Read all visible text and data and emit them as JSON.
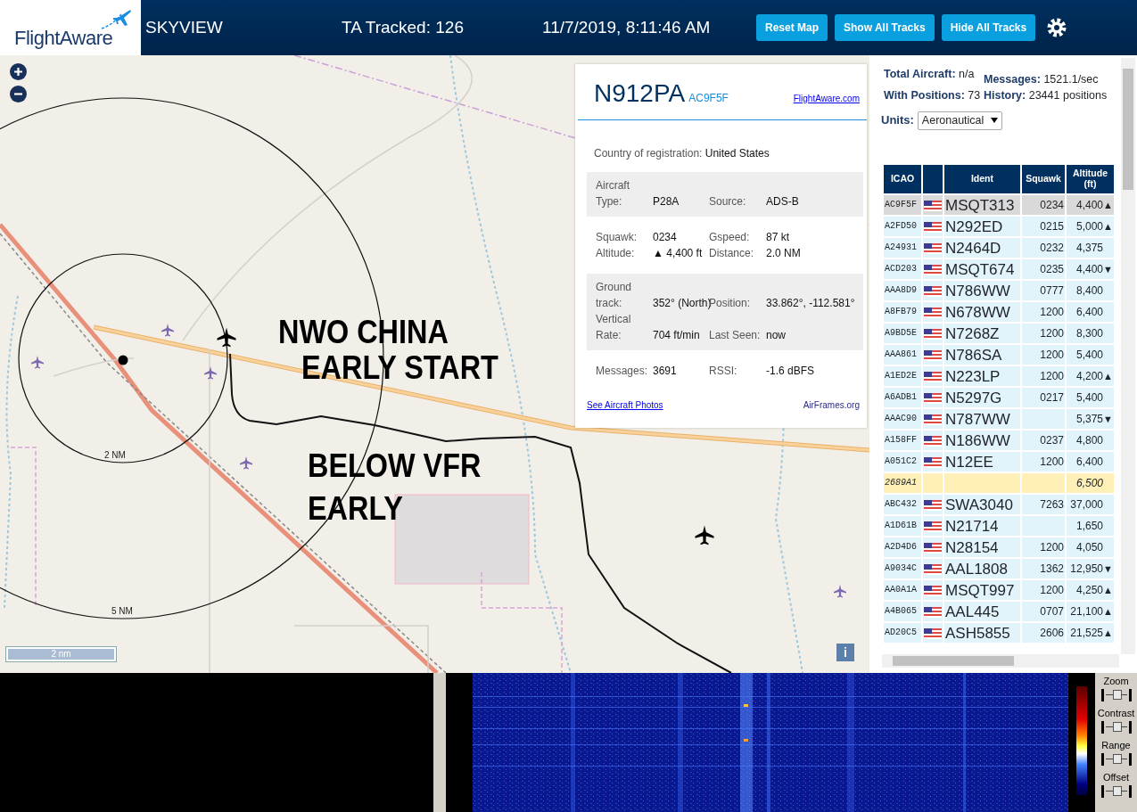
{
  "header": {
    "logo": "FlightAware",
    "title": "SKYVIEW",
    "tracked": "TA Tracked: 126",
    "datetime": "11/7/2019, 8:11:46 AM",
    "buttons": [
      "Reset Map",
      "Show All Tracks",
      "Hide All Tracks"
    ]
  },
  "map": {
    "rings": [
      "2 NM",
      "5 NM"
    ],
    "scale": "2 nm",
    "info_button": "i",
    "annotations": [
      "NWO CHINA",
      "EARLY START",
      "BELOW VFR",
      "EARLY"
    ],
    "aircraft": [
      {
        "color": "#000000"
      },
      {
        "color": "#7b68b0"
      },
      {
        "color": "#7b68b0"
      },
      {
        "color": "#7b68b0"
      },
      {
        "color": "#7b68b0"
      },
      {
        "color": "#7b68b0"
      },
      {
        "color": "#000000"
      }
    ]
  },
  "popup": {
    "ident": "N912PA",
    "icao": "AC9F5F",
    "link": "FlightAware.com",
    "country_label": "Country of registration:",
    "country": "United States",
    "sections": [
      {
        "shaded": true,
        "items": [
          {
            "label": "Aircraft Type:",
            "value": "P28A"
          },
          {
            "label": "Source:",
            "value": "ADS-B"
          }
        ]
      },
      {
        "shaded": false,
        "items": [
          {
            "label": "Squawk:",
            "value": "0234"
          },
          {
            "label": "Gspeed:",
            "value": "87 kt"
          },
          {
            "label": "Altitude:",
            "value": "▲ 4,400 ft"
          },
          {
            "label": "Distance:",
            "value": "2.0 NM"
          }
        ]
      },
      {
        "shaded": true,
        "items": [
          {
            "label": "Ground track:",
            "value": "352° (North)"
          },
          {
            "label": "Position:",
            "value": "33.862°, -112.581°"
          },
          {
            "label": "Vertical Rate:",
            "value": "704 ft/min"
          },
          {
            "label": "Last Seen:",
            "value": "now"
          }
        ]
      },
      {
        "shaded": false,
        "items": [
          {
            "label": "Messages:",
            "value": "3691"
          },
          {
            "label": "RSSI:",
            "value": "-1.6 dBFS"
          }
        ]
      }
    ],
    "photos_link": "See Aircraft Photos",
    "airframes_link": "AirFrames.org"
  },
  "panel": {
    "stats": [
      {
        "label": "Total Aircraft:",
        "value": "n/a"
      },
      {
        "label": "Messages:",
        "value": "1521.1/sec"
      },
      {
        "label": "With Positions:",
        "value": "73"
      },
      {
        "label": "History:",
        "value": "23441 positions"
      }
    ],
    "units_label": "Units:",
    "units": "Aeronautical",
    "table": {
      "columns": [
        "ICAO",
        "Ident",
        "Squawk",
        "Altitude (ft)"
      ],
      "rows": [
        {
          "icao": "AC9F5F",
          "flag": true,
          "ident": "MSQT313",
          "squawk": "0234",
          "altitude": "4,400",
          "trend": "▲",
          "selected": true,
          "kind": "standard"
        },
        {
          "icao": "A2FD50",
          "flag": true,
          "ident": "N292ED",
          "squawk": "0215",
          "altitude": "5,000",
          "trend": "▲",
          "selected": false,
          "kind": "standard"
        },
        {
          "icao": "A24931",
          "flag": true,
          "ident": "N2464D",
          "squawk": "0232",
          "altitude": "4,375",
          "selected": false,
          "kind": "standard"
        },
        {
          "icao": "ACD203",
          "flag": true,
          "ident": "MSQT674",
          "squawk": "0235",
          "altitude": "4,400",
          "trend": "▼",
          "selected": false,
          "kind": "standard"
        },
        {
          "icao": "AAA8D9",
          "flag": true,
          "ident": "N786WW",
          "squawk": "0777",
          "altitude": "8,400",
          "selected": false,
          "kind": "standard"
        },
        {
          "icao": "A8FB79",
          "flag": true,
          "ident": "N678WW",
          "squawk": "1200",
          "altitude": "6,400",
          "selected": false,
          "kind": "standard"
        },
        {
          "icao": "A9BD5E",
          "flag": true,
          "ident": "N7268Z",
          "squawk": "1200",
          "altitude": "8,300",
          "selected": false,
          "kind": "standard"
        },
        {
          "icao": "AAA861",
          "flag": true,
          "ident": "N786SA",
          "squawk": "1200",
          "altitude": "5,400",
          "selected": false,
          "kind": "standard"
        },
        {
          "icao": "A1ED2E",
          "flag": true,
          "ident": "N223LP",
          "squawk": "1200",
          "altitude": "4,200",
          "trend": "▲",
          "selected": false,
          "kind": "standard"
        },
        {
          "icao": "A6ADB1",
          "flag": true,
          "ident": "N5297G",
          "squawk": "0217",
          "altitude": "5,400",
          "selected": false,
          "kind": "standard"
        },
        {
          "icao": "AAAC90",
          "flag": true,
          "ident": "N787WW",
          "altitude": "5,375",
          "trend": "▼",
          "selected": false,
          "kind": "standard"
        },
        {
          "icao": "A158FF",
          "flag": true,
          "ident": "N186WW",
          "squawk": "0237",
          "altitude": "4,800",
          "selected": false,
          "kind": "standard"
        },
        {
          "icao": "A051C2",
          "flag": true,
          "ident": "N12EE",
          "squawk": "1200",
          "altitude": "6,400",
          "selected": false,
          "kind": "standard"
        },
        {
          "icao": "2689A1",
          "flag": false,
          "altitude": "6,500",
          "selected": false,
          "kind": "marked"
        },
        {
          "icao": "ABC432",
          "flag": true,
          "ident": "SWA3040",
          "squawk": "7263",
          "altitude": "37,000",
          "selected": false,
          "kind": "standard"
        },
        {
          "icao": "A1D61B",
          "flag": true,
          "ident": "N21714",
          "altitude": "1,650",
          "selected": false,
          "kind": "standard"
        },
        {
          "icao": "A2D4D6",
          "flag": true,
          "ident": "N28154",
          "squawk": "1200",
          "altitude": "4,050",
          "selected": false,
          "kind": "standard"
        },
        {
          "icao": "A9034C",
          "flag": true,
          "ident": "AAL1808",
          "squawk": "1362",
          "altitude": "12,950",
          "trend": "▼",
          "selected": false,
          "kind": "standard"
        },
        {
          "icao": "AA0A1A",
          "flag": true,
          "ident": "MSQT997",
          "squawk": "1200",
          "altitude": "4,250",
          "trend": "▲",
          "selected": false,
          "kind": "standard"
        },
        {
          "icao": "A4B065",
          "flag": true,
          "ident": "AAL445",
          "squawk": "0707",
          "altitude": "21,100",
          "trend": "▲",
          "selected": false,
          "kind": "standard"
        },
        {
          "icao": "AD20C5",
          "flag": true,
          "ident": "ASH5855",
          "squawk": "2606",
          "altitude": "21,525",
          "trend": "▲",
          "selected": false,
          "kind": "standard"
        }
      ]
    }
  },
  "spectrum": {
    "controls": [
      {
        "label": "Zoom",
        "level": 0.5
      },
      {
        "label": "Contrast",
        "level": 0.5
      },
      {
        "label": "Range",
        "level": 0.5
      },
      {
        "label": "Offset",
        "level": 0.5
      }
    ]
  }
}
